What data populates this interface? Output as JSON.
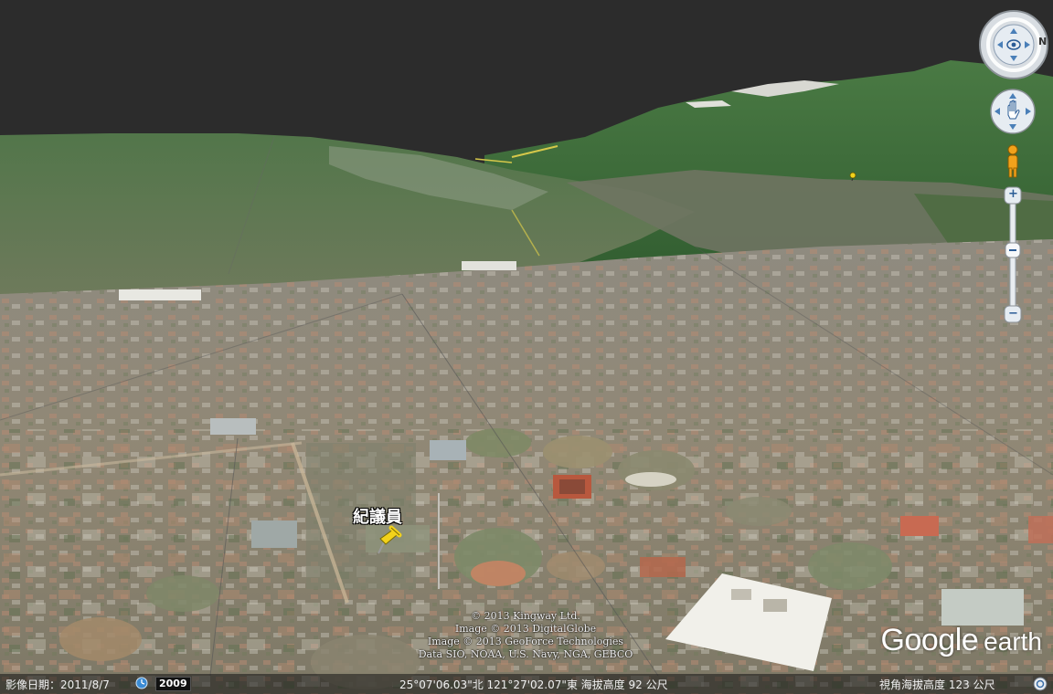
{
  "placemark": {
    "label": "紀議員"
  },
  "attribution": [
    "© 2013 Kingway Ltd.",
    "Image © 2013 DigitalGlobe",
    "Image © 2013 GeoForce Technologies",
    "Data SIO, NOAA, U.S. Navy, NGA, GEBCO"
  ],
  "logo": {
    "google": "Google",
    "earth": "earth"
  },
  "status": {
    "imagery_date": "影像日期：2011/8/7",
    "year": "2009",
    "coordinates": "25°07'06.03\"北 121°27'02.07\"東 海拔高度   92 公尺",
    "eye_altitude": "視角海拔高度     123 公尺"
  },
  "nav": {
    "compass_north": "N",
    "zoom_in": "+",
    "zoom_out": "−"
  },
  "colors": {
    "sky": "#2c2c2c",
    "mountain": "#3f6b3a",
    "ground": "#8a8576",
    "pin": "#f2d21b"
  },
  "icons": [
    "compass-icon",
    "look-icon",
    "move-hand-icon",
    "pegman-icon",
    "zoom-slider",
    "clock-icon",
    "status-icon"
  ]
}
